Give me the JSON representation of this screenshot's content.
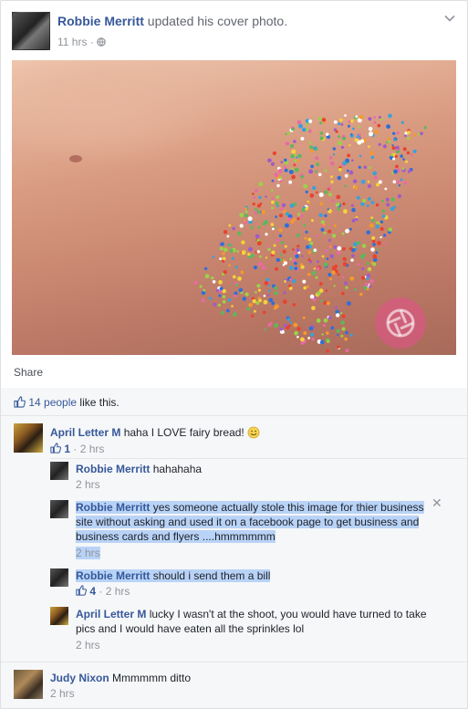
{
  "post": {
    "author": "Robbie Merritt",
    "action": "updated his cover photo.",
    "time": "11 hrs",
    "share_label": "Share",
    "likes_count": "14 people",
    "likes_suffix": "like this."
  },
  "comments": [
    {
      "author": "April Letter M",
      "text": "haha I LOVE fairy bread!",
      "likes": "1",
      "time": "2 hrs",
      "replies": [
        {
          "author": "Robbie Merritt",
          "text": "hahahaha",
          "time": "2 hrs"
        },
        {
          "author": "Robbie Merritt",
          "text_line1": "yes someone actually stole this image for thier business",
          "text_line2": "site without asking and used it on a facebook page to get business and",
          "text_line3": "business cards and flyers ....hmmmmmm",
          "time": "2 hrs"
        },
        {
          "author": "Robbie Merritt",
          "text": "should i send them a bill",
          "likes": "4",
          "time": "2 hrs"
        },
        {
          "author": "April Letter M",
          "text_line1": "lucky I wasn't at the shoot, you would have turned to take",
          "text_line2": "pics and I would have eaten all the sprinkles lol",
          "time": "2 hrs"
        }
      ]
    },
    {
      "author": "Judy Nixon",
      "text": "Mmmmmm ditto",
      "time": "2 hrs"
    }
  ],
  "icons": {
    "chevron": "chevron-down-icon",
    "globe": "globe-icon",
    "thumb": "thumbs-up-icon",
    "close": "close-icon",
    "emoji": "smiley-icon"
  },
  "colors": {
    "link": "#365899",
    "meta": "#90949c",
    "highlight": "#b9d3f7"
  }
}
